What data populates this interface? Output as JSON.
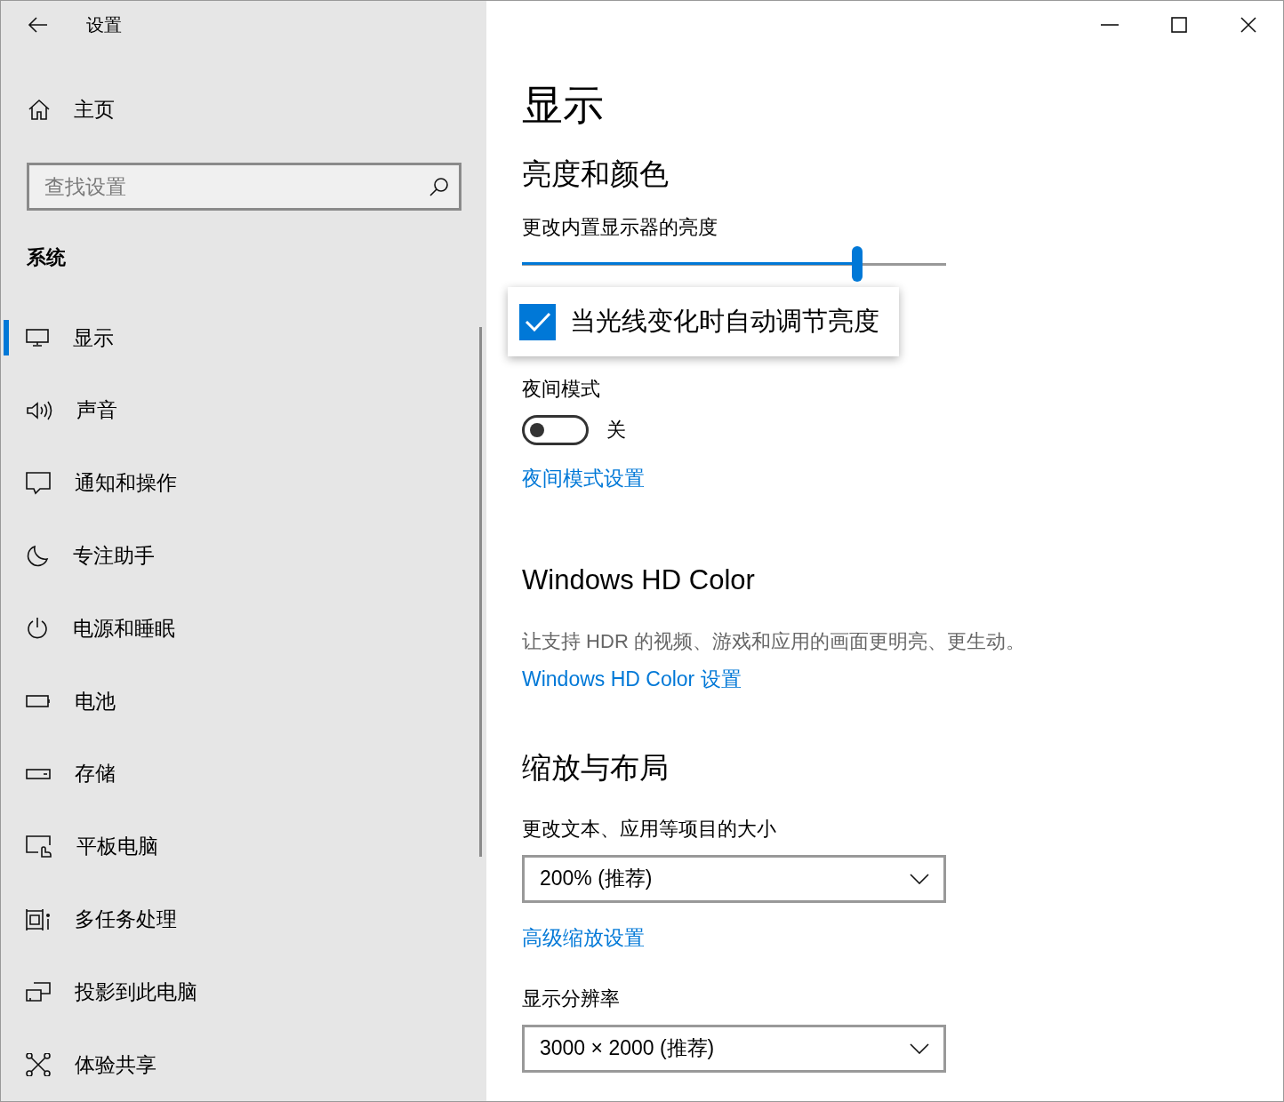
{
  "window": {
    "title": "设置"
  },
  "sidebar": {
    "home": "主页",
    "search": {
      "placeholder": "查找设置"
    },
    "section": "系统",
    "items": [
      {
        "label": "显示",
        "selected": true
      },
      {
        "label": "声音",
        "selected": false
      },
      {
        "label": "通知和操作",
        "selected": false
      },
      {
        "label": "专注助手",
        "selected": false
      },
      {
        "label": "电源和睡眠",
        "selected": false
      },
      {
        "label": "电池",
        "selected": false
      },
      {
        "label": "存储",
        "selected": false
      },
      {
        "label": "平板电脑",
        "selected": false
      },
      {
        "label": "多任务处理",
        "selected": false
      },
      {
        "label": "投影到此电脑",
        "selected": false
      },
      {
        "label": "体验共享",
        "selected": false
      }
    ]
  },
  "page": {
    "title": "显示",
    "brightness": {
      "heading": "亮度和颜色",
      "slider_label": "更改内置显示器的亮度",
      "level": 0.79,
      "auto": {
        "label": "当光线变化时自动调节亮度",
        "checked": true
      },
      "night_label": "夜间模式",
      "night_toggle": {
        "on": false,
        "state_label": "关"
      },
      "night_link": "夜间模式设置"
    },
    "hd": {
      "heading": "Windows HD Color",
      "description": "让支持 HDR 的视频、游戏和应用的画面更明亮、更生动。",
      "link": "Windows HD Color 设置"
    },
    "scale": {
      "heading": "缩放与布局",
      "size_label": "更改文本、应用等项目的大小",
      "size_value": "200% (推荐)",
      "advanced_link": "高级缩放设置",
      "resolution_label": "显示分辨率",
      "resolution_value": "3000 × 2000 (推荐)"
    }
  }
}
